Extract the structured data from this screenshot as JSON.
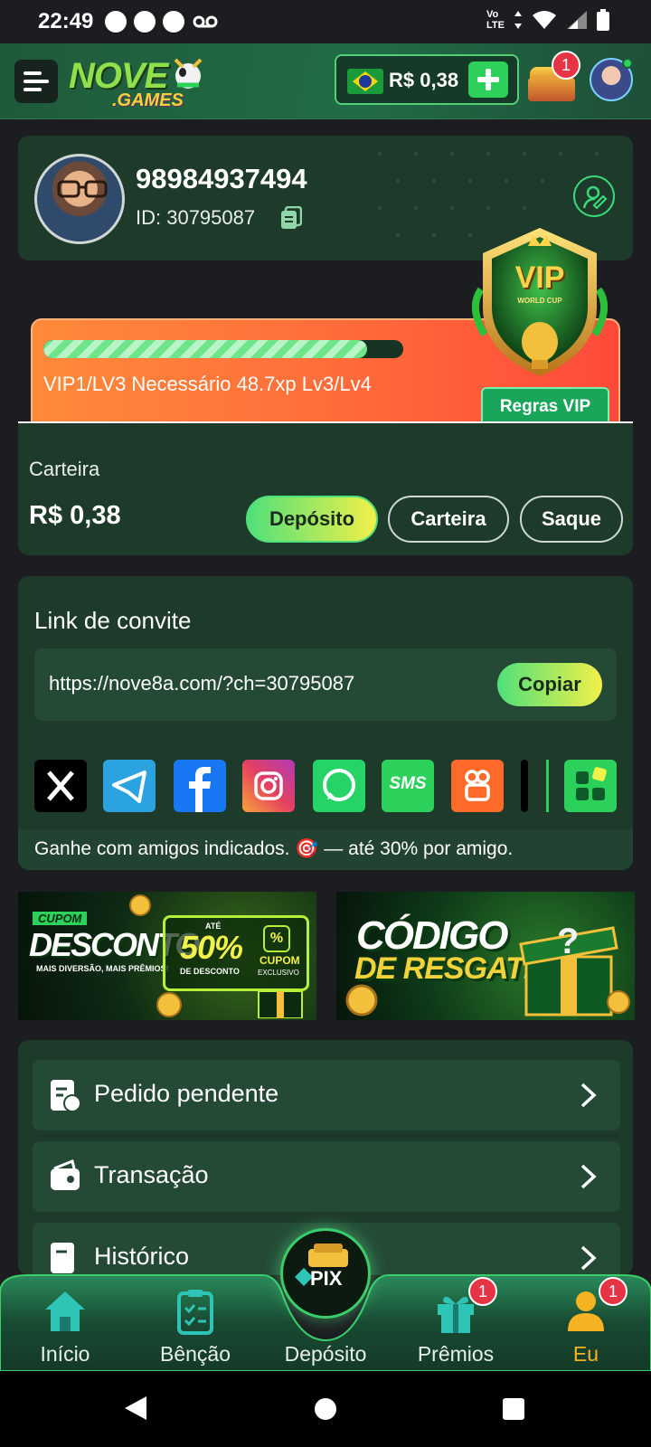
{
  "status_bar": {
    "time": "22:49",
    "network_top": "Vo",
    "network_bottom": "LTE"
  },
  "header": {
    "logo_main": "NOVE",
    "logo_sub": ".GAMES",
    "balance": "R$ 0,38",
    "chest_badge": "1"
  },
  "profile": {
    "name": "98984937494",
    "id_label": "ID: 30795087"
  },
  "vip": {
    "progress_fraction": 0.9,
    "level_text": "VIP1/LV3  Necessário 48.7xp Lv3/Lv4",
    "rules_button": "Regras VIP",
    "badge_title": "VIP",
    "badge_sub": "WORLD CUP"
  },
  "wallet": {
    "label": "Carteira",
    "amount": "R$ 0,38",
    "deposit_button": "Depósito",
    "wallet_button": "Carteira",
    "withdraw_button": "Saque"
  },
  "invite": {
    "title": "Link de convite",
    "link": "https://nove8a.com/?ch=30795087",
    "copy_button": "Copiar",
    "share_icons": [
      "x-icon",
      "telegram-icon",
      "facebook-icon",
      "instagram-icon",
      "whatsapp-icon",
      "sms-icon",
      "kwai-icon",
      "more-apps-icon"
    ],
    "sms_label": "SMS",
    "note": "Ganhe com amigos indicados. 🎯 — até 30% por amigo."
  },
  "banners": {
    "discount": {
      "tag": "CUPOM",
      "title": "DESCONTO",
      "subtitle": "MAIS DIVERSÃO, MAIS PRÊMIOS!",
      "ate": "ATÉ",
      "percent": "50%",
      "percent_sub": "DE DESCONTO",
      "coupon_line1": "CUPOM",
      "coupon_line2": "EXCLUSIVO"
    },
    "code": {
      "line1": "CÓDIGO",
      "line2": "DE RESGATE"
    }
  },
  "menu": {
    "items": [
      {
        "label": "Pedido pendente",
        "icon": "pending-order-icon"
      },
      {
        "label": "Transação",
        "icon": "wallet-icon"
      },
      {
        "label": "Histórico",
        "icon": "history-icon"
      }
    ]
  },
  "bottom_nav": {
    "home": "Início",
    "blessing": "Bênção",
    "deposit": "Depósito",
    "pix_label": "PIX",
    "prizes": "Prêmios",
    "prizes_badge": "1",
    "me": "Eu",
    "me_badge": "1"
  },
  "colors": {
    "accent_green": "#2bd15a",
    "active_nav": "#f5b324",
    "card_bg": "#1d3a2a",
    "vip_orange": "#ff6a3a"
  }
}
